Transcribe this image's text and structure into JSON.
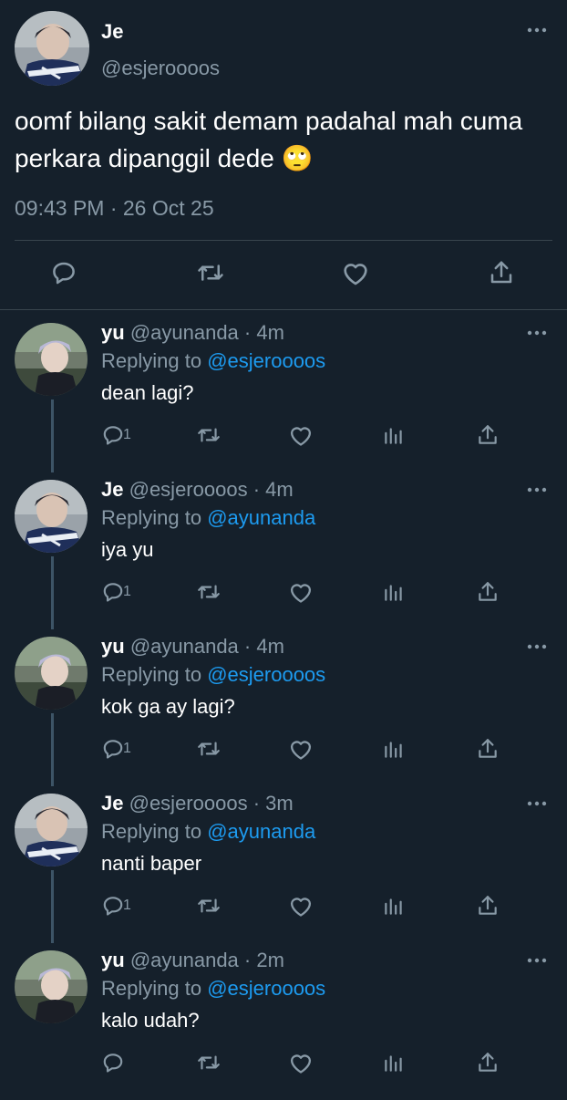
{
  "main_tweet": {
    "author_name": "Je",
    "author_handle": "@esjeroooos",
    "text": "oomf bilang sakit demam padahal mah cuma perkara dipanggil dede 🙄",
    "timestamp": "09:43 PM · 26 Oct 25",
    "icons": [
      "reply-icon",
      "retweet-icon",
      "like-icon",
      "share-icon",
      "more-icon"
    ]
  },
  "replies": [
    {
      "name": "yu",
      "handle": "@ayunanda",
      "time": "· 4m",
      "replying_label": "Replying to",
      "replying_to": "@esjeroooos",
      "text": "dean lagi?",
      "reply_count": "1",
      "avatar": "purple"
    },
    {
      "name": "Je",
      "handle": "@esjeroooos",
      "time": "· 4m",
      "replying_label": "Replying to",
      "replying_to": "@ayunanda",
      "text": "iya yu",
      "reply_count": "1",
      "avatar": "blue"
    },
    {
      "name": "yu",
      "handle": "@ayunanda",
      "time": "· 4m",
      "replying_label": "Replying to",
      "replying_to": "@esjeroooos",
      "text": "kok ga ay lagi?",
      "reply_count": "1",
      "avatar": "purple"
    },
    {
      "name": "Je",
      "handle": "@esjeroooos",
      "time": "· 3m",
      "replying_label": "Replying to",
      "replying_to": "@ayunanda",
      "text": "nanti baper",
      "reply_count": "1",
      "avatar": "blue"
    },
    {
      "name": "yu",
      "handle": "@ayunanda",
      "time": "· 2m",
      "replying_label": "Replying to",
      "replying_to": "@esjeroooos",
      "text": "kalo udah?",
      "reply_count": "",
      "avatar": "purple"
    }
  ],
  "reply_icons": [
    "reply-icon",
    "retweet-icon",
    "like-icon",
    "analytics-icon",
    "share-icon"
  ],
  "colors": {
    "background": "#15202b",
    "secondary_text": "#8899a6",
    "mention": "#1d9bf0",
    "divider": "#38444d"
  }
}
